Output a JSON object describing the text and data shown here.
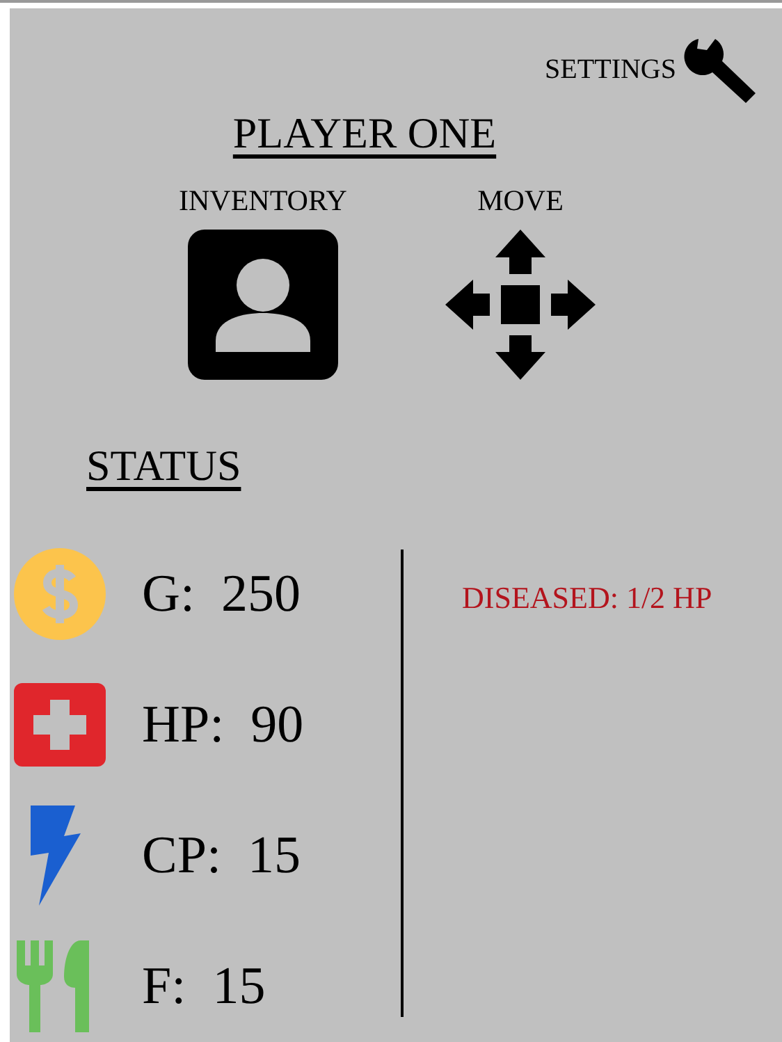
{
  "settings": {
    "label": "SETTINGS"
  },
  "player": {
    "name": "PLAYER ONE"
  },
  "actions": [
    {
      "kind": "inventory",
      "label": "INVENTORY"
    },
    {
      "kind": "move",
      "label": "MOVE"
    }
  ],
  "status": {
    "heading": "STATUS",
    "stats": [
      {
        "kind": "gold",
        "label": "G:",
        "value": "250"
      },
      {
        "kind": "health",
        "label": "HP:",
        "value": "90"
      },
      {
        "kind": "energy",
        "label": "CP:",
        "value": "15"
      },
      {
        "kind": "food",
        "label": "F:",
        "value": "15"
      }
    ],
    "conditions": [
      "DISEASED: 1/2 HP"
    ]
  }
}
